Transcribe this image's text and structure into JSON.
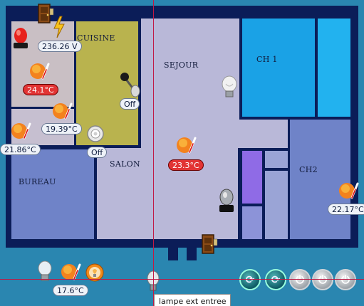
{
  "rooms": {
    "cuisine": "CUISINE",
    "sejour": "SEJOUR",
    "ch1": "CH 1",
    "ch2": "CH2",
    "salon": "SALON",
    "bureau": "BUREAU"
  },
  "readings": {
    "voltage": "236.26 V",
    "temp_kitchen_corner": "24.1°C",
    "temp_kitchen_low": "19.39°C",
    "temp_left": "21.86°C",
    "temp_sejour": "23.3°C",
    "temp_ch2": "22.17°C",
    "temp_outside": "17.6°C"
  },
  "switches": {
    "kitchen_lever_state": "Off",
    "kitchen_lamp_state": "Off"
  },
  "tooltip": {
    "text": "lampe  ext entree"
  },
  "controls": {
    "refresh_1": "refresh",
    "refresh_2": "refresh",
    "power_1": "power",
    "power_2": "power",
    "power_3": "power"
  },
  "colors": {
    "floor_bg": "#2a86b0",
    "wall": "#0b1d58",
    "cuisine": "#b9b34e",
    "sejour": "#b9b8d8",
    "ch1": "#1aa2e6",
    "bureau": "#6f83c8",
    "badge_red": "#e23434",
    "crosshair": "#c01a45"
  }
}
